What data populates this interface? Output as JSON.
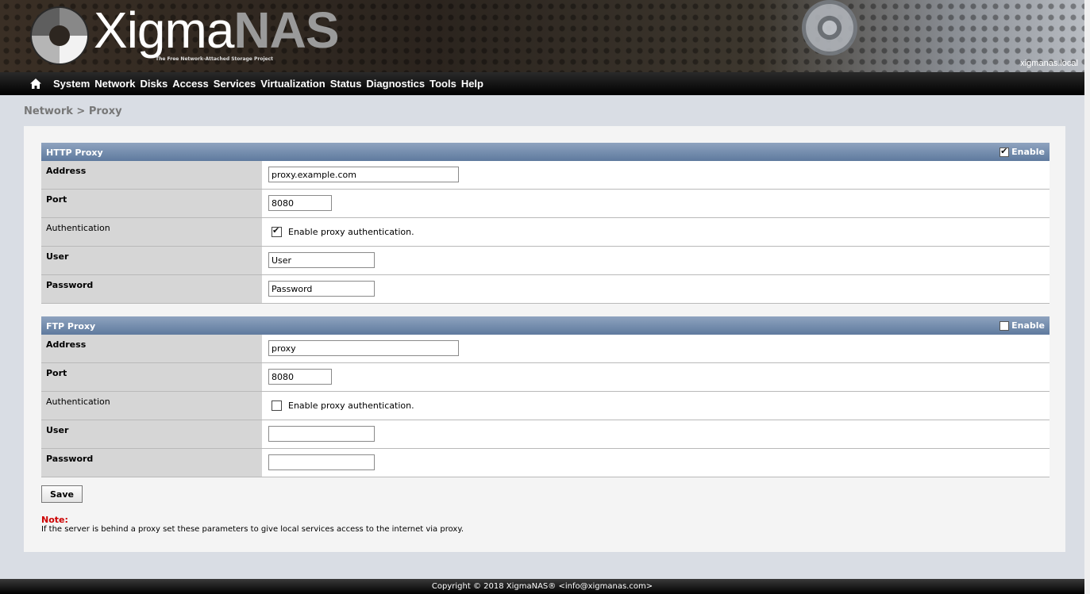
{
  "header": {
    "logo_word": "Xigma",
    "logo_nas": "NAS",
    "logo_tagline": "The Free Network-Attached Storage Project",
    "hostname": "xigmanas.local"
  },
  "nav": {
    "items": [
      "System",
      "Network",
      "Disks",
      "Access",
      "Services",
      "Virtualization",
      "Status",
      "Diagnostics",
      "Tools",
      "Help"
    ]
  },
  "breadcrumb": "Network > Proxy",
  "http": {
    "title": "HTTP Proxy",
    "enable_label": "Enable",
    "enabled": true,
    "address_label": "Address",
    "address_value": "proxy.example.com",
    "port_label": "Port",
    "port_value": "8080",
    "auth_label": "Authentication",
    "auth_text": "Enable proxy authentication.",
    "auth_checked": true,
    "user_label": "User",
    "user_value": "User",
    "password_label": "Password",
    "password_value": "Password"
  },
  "ftp": {
    "title": "FTP Proxy",
    "enable_label": "Enable",
    "enabled": false,
    "address_label": "Address",
    "address_value": "proxy",
    "port_label": "Port",
    "port_value": "8080",
    "auth_label": "Authentication",
    "auth_text": "Enable proxy authentication.",
    "auth_checked": false,
    "user_label": "User",
    "user_value": "",
    "password_label": "Password",
    "password_value": ""
  },
  "save_label": "Save",
  "note": {
    "title": "Note:",
    "text": "If the server is behind a proxy set these parameters to give local services access to the internet via proxy."
  },
  "footer": "Copyright © 2018 XigmaNAS® <info@xigmanas.com>"
}
